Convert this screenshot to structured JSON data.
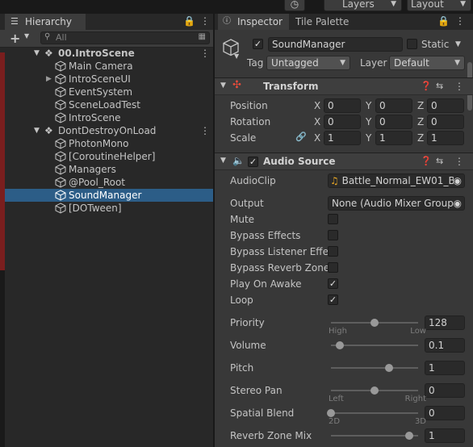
{
  "toolbar": {
    "history_icon": "history-icon",
    "layers_label": "Layers",
    "layout_label": "Layout"
  },
  "hierarchy": {
    "tab_label": "Hierarchy",
    "search_placeholder": "All",
    "add_label": "+",
    "rows": [
      {
        "label": "00.IntroScene",
        "kind": "scene"
      },
      {
        "label": "Main Camera",
        "kind": "object"
      },
      {
        "label": "IntroSceneUI",
        "kind": "object"
      },
      {
        "label": "EventSystem",
        "kind": "object"
      },
      {
        "label": "SceneLoadTest",
        "kind": "object"
      },
      {
        "label": "IntroScene",
        "kind": "object"
      },
      {
        "label": "DontDestroyOnLoad",
        "kind": "scene"
      },
      {
        "label": "PhotonMono",
        "kind": "object"
      },
      {
        "label": "[CoroutineHelper]",
        "kind": "object"
      },
      {
        "label": "Managers",
        "kind": "object"
      },
      {
        "label": "@Pool_Root",
        "kind": "object"
      },
      {
        "label": "SoundManager",
        "kind": "object",
        "selected": true
      },
      {
        "label": "[DOTween]",
        "kind": "object"
      }
    ]
  },
  "inspector": {
    "tab_inspector": "Inspector",
    "tab_tile_palette": "Tile Palette",
    "object_name": "SoundManager",
    "static_label": "Static",
    "tag_label": "Tag",
    "tag_value": "Untagged",
    "layer_label": "Layer",
    "layer_value": "Default",
    "transform": {
      "title": "Transform",
      "rows": [
        {
          "label": "Position",
          "x": "0",
          "y": "0",
          "z": "0"
        },
        {
          "label": "Rotation",
          "x": "0",
          "y": "0",
          "z": "0"
        },
        {
          "label": "Scale",
          "x": "1",
          "y": "1",
          "z": "1"
        }
      ],
      "axis_x": "X",
      "axis_y": "Y",
      "axis_z": "Z"
    },
    "audio_source": {
      "title": "Audio Source",
      "audioclip_label": "AudioClip",
      "audioclip_value": "Battle_Normal_EW01_B",
      "output_label": "Output",
      "output_value": "None (Audio Mixer Group)",
      "toggles": [
        {
          "label": "Mute",
          "checked": false
        },
        {
          "label": "Bypass Effects",
          "checked": false
        },
        {
          "label": "Bypass Listener Effec",
          "checked": false
        },
        {
          "label": "Bypass Reverb Zones",
          "checked": false
        },
        {
          "label": "Play On Awake",
          "checked": true
        },
        {
          "label": "Loop",
          "checked": true
        }
      ],
      "sliders": [
        {
          "label": "Priority",
          "value": "128",
          "fraction": 0.5,
          "min_cap": "High",
          "max_cap": "Low"
        },
        {
          "label": "Volume",
          "value": "0.1",
          "fraction": 0.1,
          "min_cap": "",
          "max_cap": ""
        },
        {
          "label": "Pitch",
          "value": "1",
          "fraction": 0.67,
          "min_cap": "",
          "max_cap": ""
        },
        {
          "label": "Stereo Pan",
          "value": "0",
          "fraction": 0.5,
          "min_cap": "Left",
          "max_cap": "Right"
        },
        {
          "label": "Spatial Blend",
          "value": "0",
          "fraction": 0.0,
          "min_cap": "2D",
          "max_cap": "3D"
        },
        {
          "label": "Reverb Zone Mix",
          "value": "1",
          "fraction": 0.9,
          "min_cap": "",
          "max_cap": ""
        }
      ]
    }
  },
  "colors": {
    "selection": "#2c5d87",
    "accent_audio": "#e9a825"
  }
}
